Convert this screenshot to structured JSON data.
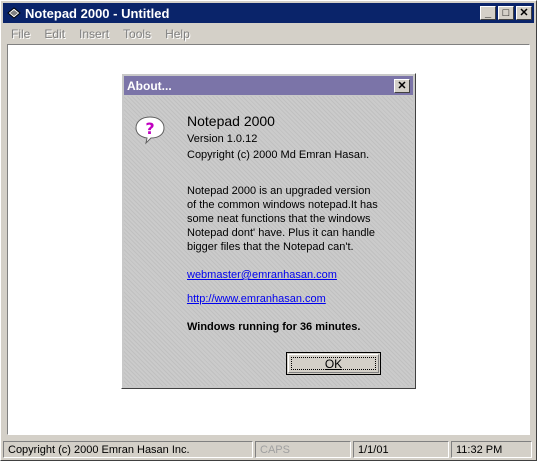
{
  "window": {
    "title": "Notepad 2000 - Untitled",
    "icon": "notepad-diamond-icon"
  },
  "menu": [
    {
      "label": "File"
    },
    {
      "label": "Edit"
    },
    {
      "label": "Insert"
    },
    {
      "label": "Tools"
    },
    {
      "label": "Help"
    }
  ],
  "statusbar": {
    "copyright": "Copyright (c) 2000 Emran Hasan Inc.",
    "caps": "CAPS",
    "date": "1/1/01",
    "time": "11:32 PM"
  },
  "about": {
    "title": "About...",
    "icon": "question-balloon-icon",
    "app_name": "Notepad 2000",
    "version": "Version 1.0.12",
    "copyright": "Copyright (c) 2000 Md Emran Hasan.",
    "desc_lines": [
      "Notepad 2000 is an upgraded version",
      "of the common windows notepad.It has",
      "some neat functions that the windows",
      "Notepad dont' have. Plus it can handle",
      "bigger files that the Notepad can't."
    ],
    "email": "webmaster@emranhasan.com",
    "website": "http://www.emranhasan.com",
    "runtime": "Windows running for 36 minutes.",
    "ok_label": "OK"
  },
  "colors": {
    "title_active": "#0a246a",
    "dialog_title": "#7b74a8",
    "link": "#0000ee"
  }
}
